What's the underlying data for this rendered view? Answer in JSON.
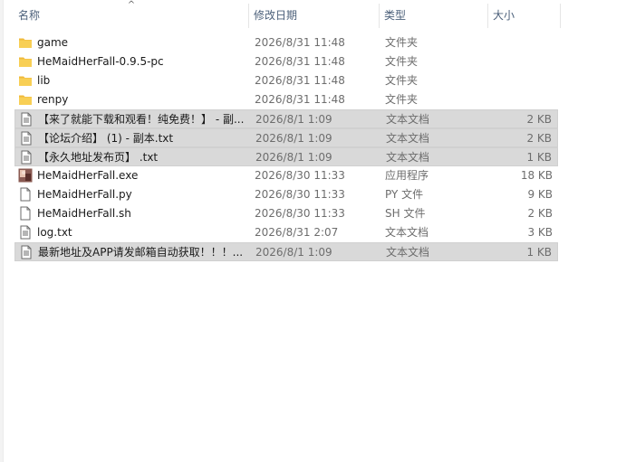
{
  "columns": {
    "name": "名称",
    "date": "修改日期",
    "type": "类型",
    "size": "大小",
    "sort_indicator": "^"
  },
  "files": [
    {
      "name": "game",
      "date": "2026/8/31 11:48",
      "type": "文件夹",
      "size": "",
      "icon": "folder-icon",
      "selected": false
    },
    {
      "name": "HeMaidHerFall-0.9.5-pc",
      "date": "2026/8/31 11:48",
      "type": "文件夹",
      "size": "",
      "icon": "folder-icon",
      "selected": false
    },
    {
      "name": "lib",
      "date": "2026/8/31 11:48",
      "type": "文件夹",
      "size": "",
      "icon": "folder-icon",
      "selected": false
    },
    {
      "name": "renpy",
      "date": "2026/8/31 11:48",
      "type": "文件夹",
      "size": "",
      "icon": "folder-icon",
      "selected": false
    },
    {
      "name": "【来了就能下载和观看！纯免费！】 - 副...",
      "date": "2026/8/1 1:09",
      "type": "文本文档",
      "size": "2 KB",
      "icon": "text-file-icon",
      "selected": true
    },
    {
      "name": "【论坛介绍】 (1) - 副本.txt",
      "date": "2026/8/1 1:09",
      "type": "文本文档",
      "size": "2 KB",
      "icon": "text-file-icon",
      "selected": true
    },
    {
      "name": "【永久地址发布页】 .txt",
      "date": "2026/8/1 1:09",
      "type": "文本文档",
      "size": "1 KB",
      "icon": "text-file-icon",
      "selected": true
    },
    {
      "name": "HeMaidHerFall.exe",
      "date": "2026/8/30 11:33",
      "type": "应用程序",
      "size": "18 KB",
      "icon": "application-icon",
      "selected": false
    },
    {
      "name": "HeMaidHerFall.py",
      "date": "2026/8/30 11:33",
      "type": "PY 文件",
      "size": "9 KB",
      "icon": "blank-file-icon",
      "selected": false
    },
    {
      "name": "HeMaidHerFall.sh",
      "date": "2026/8/30 11:33",
      "type": "SH 文件",
      "size": "2 KB",
      "icon": "blank-file-icon",
      "selected": false
    },
    {
      "name": "log.txt",
      "date": "2026/8/31 2:07",
      "type": "文本文档",
      "size": "3 KB",
      "icon": "text-file-icon",
      "selected": false
    },
    {
      "name": "最新地址及APP请发邮箱自动获取！！！...",
      "date": "2026/8/1 1:09",
      "type": "文本文档",
      "size": "1 KB",
      "icon": "text-file-icon",
      "selected": true
    }
  ],
  "colors": {
    "header_text": "#4c607a",
    "selection": "#d9d9d9",
    "folder": "#f4c542",
    "secondary_text": "#6d6d6d"
  }
}
